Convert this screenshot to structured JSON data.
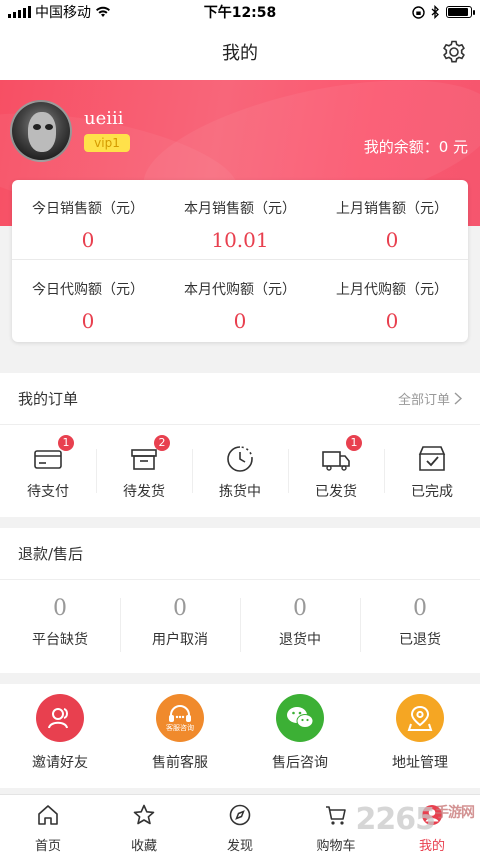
{
  "status_bar": {
    "carrier": "中国移动",
    "time": "下午12:58"
  },
  "nav": {
    "title": "我的"
  },
  "profile": {
    "username": "ueiii",
    "vip_level": "vip1",
    "balance": "我的余额：0 元"
  },
  "stats": [
    {
      "label": "今日销售额（元）",
      "value": "0"
    },
    {
      "label": "本月销售额（元）",
      "value": "10.01"
    },
    {
      "label": "上月销售额（元）",
      "value": "0"
    },
    {
      "label": "今日代购额（元）",
      "value": "0"
    },
    {
      "label": "本月代购额（元）",
      "value": "0"
    },
    {
      "label": "上月代购额（元）",
      "value": "0"
    }
  ],
  "orders": {
    "title": "我的订单",
    "all_link": "全部订单",
    "items": [
      {
        "label": "待支付",
        "icon": "card-icon",
        "badge": "1"
      },
      {
        "label": "待发货",
        "icon": "box-icon",
        "badge": "2"
      },
      {
        "label": "拣货中",
        "icon": "clock-icon",
        "badge": ""
      },
      {
        "label": "已发货",
        "icon": "truck-icon",
        "badge": "1"
      },
      {
        "label": "已完成",
        "icon": "done-box-icon",
        "badge": ""
      }
    ]
  },
  "refund": {
    "title": "退款/售后",
    "items": [
      {
        "label": "平台缺货",
        "value": "0"
      },
      {
        "label": "用户取消",
        "value": "0"
      },
      {
        "label": "退货中",
        "value": "0"
      },
      {
        "label": "已退货",
        "value": "0"
      }
    ]
  },
  "services": [
    {
      "label": "邀请好友",
      "icon": "invite-icon",
      "color": "#e8404f"
    },
    {
      "label": "售前客服",
      "icon": "headset-icon",
      "color": "#f08a2c",
      "icon_text": "客服咨询"
    },
    {
      "label": "售后咨询",
      "icon": "wechat-icon",
      "color": "#3cb035"
    },
    {
      "label": "地址管理",
      "icon": "location-icon",
      "color": "#f5a623"
    }
  ],
  "tabs": [
    {
      "label": "首页",
      "icon": "home-icon"
    },
    {
      "label": "收藏",
      "icon": "star-icon"
    },
    {
      "label": "发现",
      "icon": "compass-icon"
    },
    {
      "label": "购物车",
      "icon": "cart-icon"
    },
    {
      "label": "我的",
      "icon": "user-icon",
      "active": true
    }
  ],
  "watermark": "2265",
  "watermark_suffix": "手游网",
  "colors": {
    "accent": "#e8404f",
    "hero_start": "#f74f64",
    "hero_end": "#f5566e"
  }
}
